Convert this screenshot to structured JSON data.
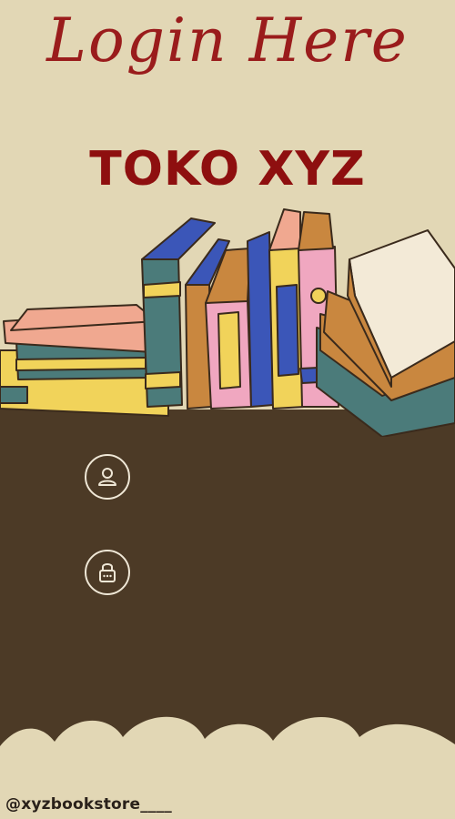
{
  "header": {
    "title": "Login Here",
    "store_name": "TOKO XYZ"
  },
  "form": {
    "username": {
      "icon": "user-icon",
      "value": ""
    },
    "password": {
      "icon": "lock-icon",
      "value": ""
    }
  },
  "footer": {
    "handle": "@xyzbookstore____"
  },
  "colors": {
    "title_red": "#9a1c1c",
    "background_cream": "#e2d7b5",
    "panel_brown": "#4c3a26",
    "icon_outline": "#efe7d6"
  }
}
